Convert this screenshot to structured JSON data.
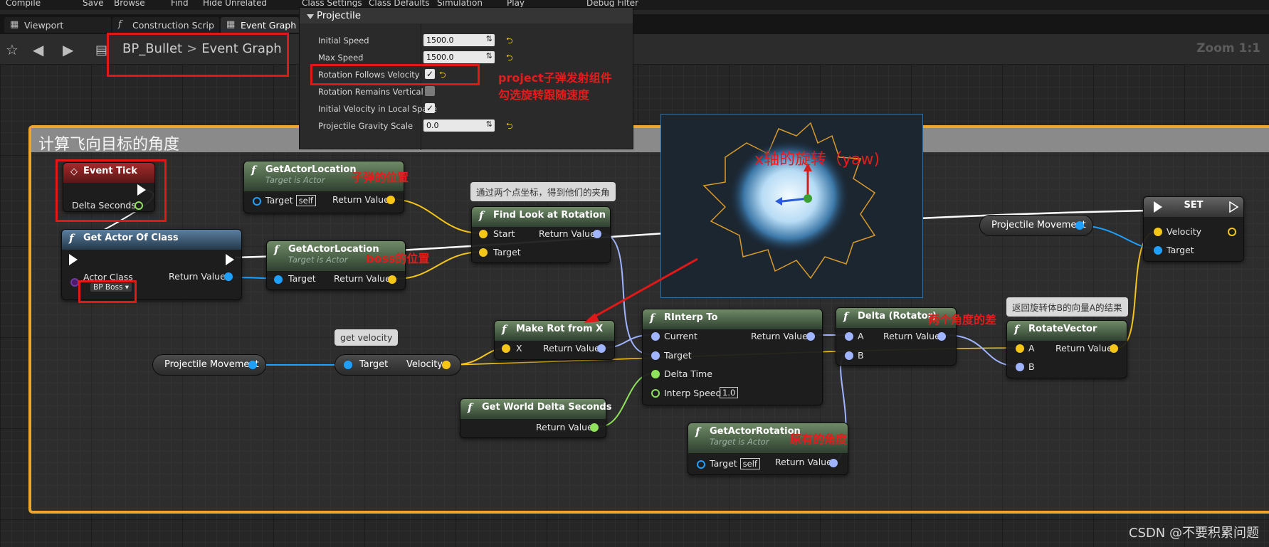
{
  "toolbar": {
    "compile": "Compile",
    "save": "Save",
    "browse": "Browse",
    "find": "Find",
    "hide_unrelated": "Hide Unrelated",
    "class_settings": "Class Settings",
    "class_defaults": "Class Defaults",
    "simulation": "Simulation",
    "play": "Play",
    "debug_filter": "Debug Filter"
  },
  "tabs": [
    {
      "label": "Viewport",
      "icon": "viewport-icon"
    },
    {
      "label": "Construction Scrip",
      "icon": "function-icon"
    },
    {
      "label": "Event Graph",
      "icon": "graph-icon"
    }
  ],
  "breadcrumb": {
    "blueprint": "BP_Bullet",
    "separator": ">",
    "graph": "Event Graph"
  },
  "zoom": "Zoom 1:1",
  "details": {
    "section": "Projectile",
    "rows": [
      {
        "label": "Initial Speed",
        "value": "1500.0"
      },
      {
        "label": "Max Speed",
        "value": "1500.0"
      },
      {
        "label": "Rotation Follows Velocity",
        "checked": true
      },
      {
        "label": "Rotation Remains Vertical",
        "checked": false
      },
      {
        "label": "Initial Velocity in Local Space",
        "checked": true
      },
      {
        "label": "Projectile Gravity Scale",
        "value": "0.0"
      }
    ]
  },
  "comment_title": "计算飞向目标的角度",
  "nodes": {
    "event_tick": {
      "title": "Event Tick",
      "delta": "Delta Seconds"
    },
    "get_actor_of_class": {
      "title": "Get Actor Of Class",
      "actor_class_label": "Actor Class",
      "actor_class_value": "BP Boss",
      "return": "Return Value"
    },
    "get_actor_location_1": {
      "title": "GetActorLocation",
      "sub": "Target is Actor",
      "target": "Target",
      "self": "self",
      "return": "Return Value"
    },
    "get_actor_location_2": {
      "title": "GetActorLocation",
      "sub": "Target is Actor",
      "target": "Target",
      "return": "Return Value"
    },
    "find_look_at": {
      "title": "Find Look at Rotation",
      "start": "Start",
      "target": "Target",
      "return": "Return Value"
    },
    "make_rot_from_x": {
      "title": "Make Rot from X",
      "x": "X",
      "return": "Return Value"
    },
    "rinterp_to": {
      "title": "RInterp To",
      "current": "Current",
      "target": "Target",
      "delta_time": "Delta Time",
      "interp_speed": "Interp Speed",
      "interp_value": "1.0",
      "return": "Return Value"
    },
    "delta_rotator": {
      "title": "Delta (Rotator)",
      "a": "A",
      "b": "B",
      "return": "Return Value"
    },
    "rotate_vector": {
      "title": "RotateVector",
      "a": "A",
      "b": "B",
      "return": "Return Value"
    },
    "get_world_delta": {
      "title": "Get World Delta Seconds",
      "return": "Return Value"
    },
    "get_actor_rotation": {
      "title": "GetActorRotation",
      "sub": "Target is Actor",
      "target": "Target",
      "self": "self",
      "return": "Return Value"
    },
    "get_velocity": {
      "target": "Target",
      "velocity": "Velocity"
    },
    "set": {
      "title": "SET",
      "velocity": "Velocity",
      "target": "Target"
    },
    "projectile_movement_1": "Projectile Movement",
    "projectile_movement_2": "Projectile Movement"
  },
  "bubbles": {
    "find_look_at": "通过两个点坐标，得到他们的夹角",
    "get_velocity": "get velocity",
    "rotate_vector": "返回旋转体B的向量A的结果"
  },
  "annotations": {
    "project_line1": "project子弹发射组件",
    "project_line2": "勾选旋转跟随速度",
    "bullet_pos": "子弹的位置",
    "boss_pos": "boss的位置",
    "yaw": "x轴的旋转（yaw)",
    "angle_diff": "两个角度的差",
    "orig_angle": "原有的角度"
  },
  "watermark": "CSDN @不要积累问题",
  "colors": {
    "accent": "#f0a62c",
    "annotation": "#e01818"
  }
}
